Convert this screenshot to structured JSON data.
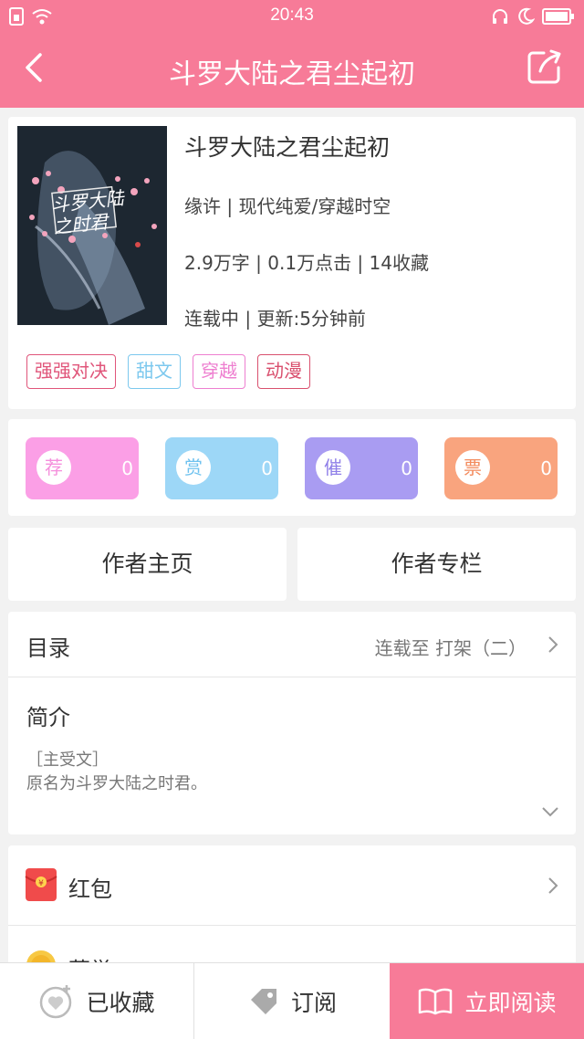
{
  "status": {
    "time": "20:43"
  },
  "header": {
    "title": "斗罗大陆之君尘起初"
  },
  "book": {
    "title": "斗罗大陆之君尘起初",
    "author_genre": "缘许 | 现代纯爱/穿越时空",
    "stats": "2.9万字 | 0.1万点击 | 14收藏",
    "update": "连载中 | 更新:5分钟前",
    "cover_text": "斗罗大陆之时君",
    "tags": [
      {
        "label": "强强对决",
        "color": "#e0557a"
      },
      {
        "label": "甜文",
        "color": "#7cc8ee"
      },
      {
        "label": "穿越",
        "color": "#ee7fd0"
      },
      {
        "label": "动漫",
        "color": "#d9506e"
      }
    ]
  },
  "rewards": [
    {
      "icon_char": "荐",
      "count": "0",
      "color": "#fb9fe6",
      "icon_color": "#f58fdc"
    },
    {
      "icon_char": "赏",
      "count": "0",
      "color": "#9dd7f7",
      "icon_color": "#6fc2ef"
    },
    {
      "icon_char": "催",
      "count": "0",
      "color": "#a99cf2",
      "icon_color": "#8f7fe8"
    },
    {
      "icon_char": "票",
      "count": "0",
      "color": "#f9a47e",
      "icon_color": "#f38a5c"
    }
  ],
  "author_links": {
    "home": "作者主页",
    "column": "作者专栏"
  },
  "toc": {
    "label": "目录",
    "status": "连载至 打架（二）"
  },
  "intro": {
    "label": "简介",
    "line1": "［主受文］",
    "line2": "原名为斗罗大陆之时君。"
  },
  "bonus": {
    "red_packet": "红包",
    "second_partial": "荣誉"
  },
  "bottom": {
    "favorited": "已收藏",
    "subscribe": "订阅",
    "read_now": "立即阅读"
  },
  "colors": {
    "brand": "#f77b98",
    "background": "#f2f2f2"
  }
}
